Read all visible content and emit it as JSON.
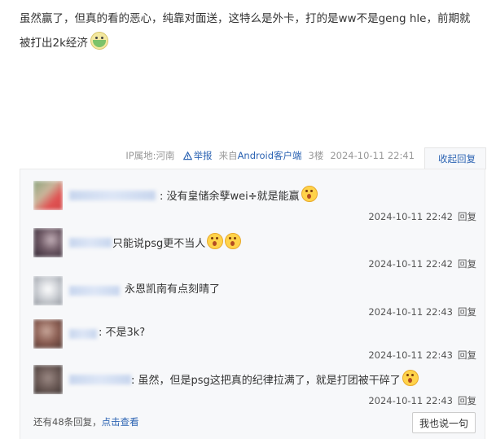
{
  "post": {
    "text_line1": "虽然赢了，但真的看的恶心，纯靠对面送，这特么是外卡，打的是ww不是geng hle，前期就",
    "text_line2": "被打出2k经济",
    "emoji": "sick-face-icon"
  },
  "meta": {
    "ip": "IP属地:河南",
    "report": "举报",
    "from_prefix": "来自",
    "from_client": "Android客户端",
    "floor": "3楼",
    "time": "2024-10-11 22:41",
    "collapse": "收起回复"
  },
  "replies": [
    {
      "text": ": 没有皇储余孽wei",
      "text_after": "就是能赢",
      "icons": [
        "divide-icon",
        "shocked-face-icon"
      ],
      "time": "2024-10-11 22:42",
      "reply": "回复"
    },
    {
      "text": "只能说psg更不当人",
      "icons": [
        "shocked-face-icon",
        "shocked-face-icon"
      ],
      "time": "2024-10-11 22:42",
      "reply": "回复"
    },
    {
      "text": "永恩凯南有点刻晴了",
      "time": "2024-10-11 22:43",
      "reply": "回复"
    },
    {
      "text": ": 不是3k?",
      "time": "2024-10-11 22:43",
      "reply": "回复"
    },
    {
      "text": ": 虽然，但是psg这把真的纪律拉满了，就是打团被干碎了",
      "icons": [
        "shocked-face-icon"
      ],
      "time": "2024-10-11 22:43",
      "reply": "回复"
    }
  ],
  "footer": {
    "more_prefix": "还有48条回复，",
    "more_link": "点击查看",
    "say_button": "我也说一句"
  },
  "colors": {
    "link": "#2d64b3",
    "box_bg": "#f7f8fa"
  }
}
